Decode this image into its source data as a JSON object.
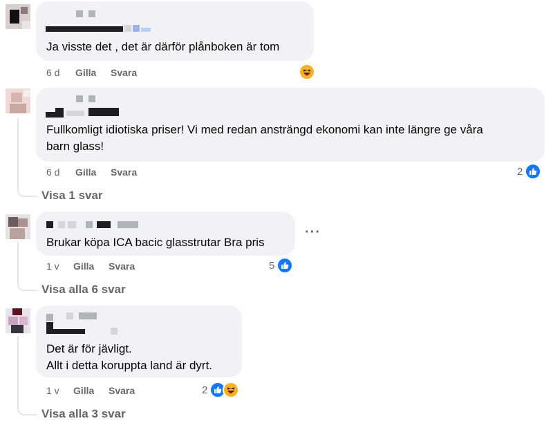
{
  "comments": [
    {
      "text_lines": [
        "Ja visste det , det är därför plånboken är tom"
      ],
      "time": "6 d",
      "like_label": "Gilla",
      "reply_label": "Svara",
      "reactions": {
        "icons": [
          "haha-icon"
        ],
        "count": ""
      }
    },
    {
      "text_lines": [
        "Fullkomligt idiotiska priser! Vi med redan ansträngd ekonomi kan inte längre ge våra",
        "barn glass!"
      ],
      "time": "6 d",
      "like_label": "Gilla",
      "reply_label": "Svara",
      "reactions": {
        "icons": [
          "like-icon"
        ],
        "count": "2"
      },
      "view_replies": "Visa 1 svar"
    },
    {
      "text_lines": [
        "Brukar köpa ICA bacic glasstrutar Bra pris"
      ],
      "time": "1 v",
      "like_label": "Gilla",
      "reply_label": "Svara",
      "reactions": {
        "icons": [
          "like-icon"
        ],
        "count": "5"
      },
      "more_label": "···",
      "view_replies": "Visa alla 6 svar"
    },
    {
      "text_lines": [
        "Det är för jävligt.",
        "Allt i detta koruppta land är dyrt."
      ],
      "time": "1 v",
      "like_label": "Gilla",
      "reply_label": "Svara",
      "reactions": {
        "icons": [
          "like-icon",
          "haha-icon"
        ],
        "count": "2"
      },
      "view_replies": "Visa alla 3 svar"
    }
  ],
  "colors": {
    "bubble": "#f0f2f5",
    "meta": "#65676b",
    "like": "#1877f2",
    "haha": "#f7b125"
  }
}
